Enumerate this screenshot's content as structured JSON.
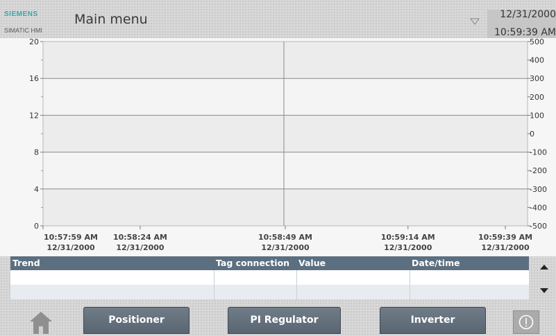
{
  "header": {
    "brand": "SIEMENS",
    "product": "SIMATIC HMI",
    "title": "Main menu",
    "date": "12/31/2000",
    "time": "10:59:39 AM"
  },
  "trend": {
    "left_axis": [
      "20",
      "16",
      "12",
      "8",
      "4",
      "0"
    ],
    "right_axis": [
      "500",
      "400",
      "300",
      "200",
      "100",
      "0",
      "-100",
      "-200",
      "-300",
      "-400",
      "-500"
    ],
    "time_axis": [
      {
        "time": "10:57:59 AM",
        "date": "12/31/2000"
      },
      {
        "time": "10:58:24 AM",
        "date": "12/31/2000"
      },
      {
        "time": "10:58:49 AM",
        "date": "12/31/2000"
      },
      {
        "time": "10:59:14 AM",
        "date": "12/31/2000"
      },
      {
        "time": "10:59:39 AM",
        "date": "12/31/2000"
      }
    ]
  },
  "table": {
    "headers": [
      "Trend",
      "Tag connection",
      "Value",
      "Date/time"
    ]
  },
  "footer": {
    "buttons": [
      "Positioner",
      "PI Regulator",
      "Inverter"
    ]
  }
}
